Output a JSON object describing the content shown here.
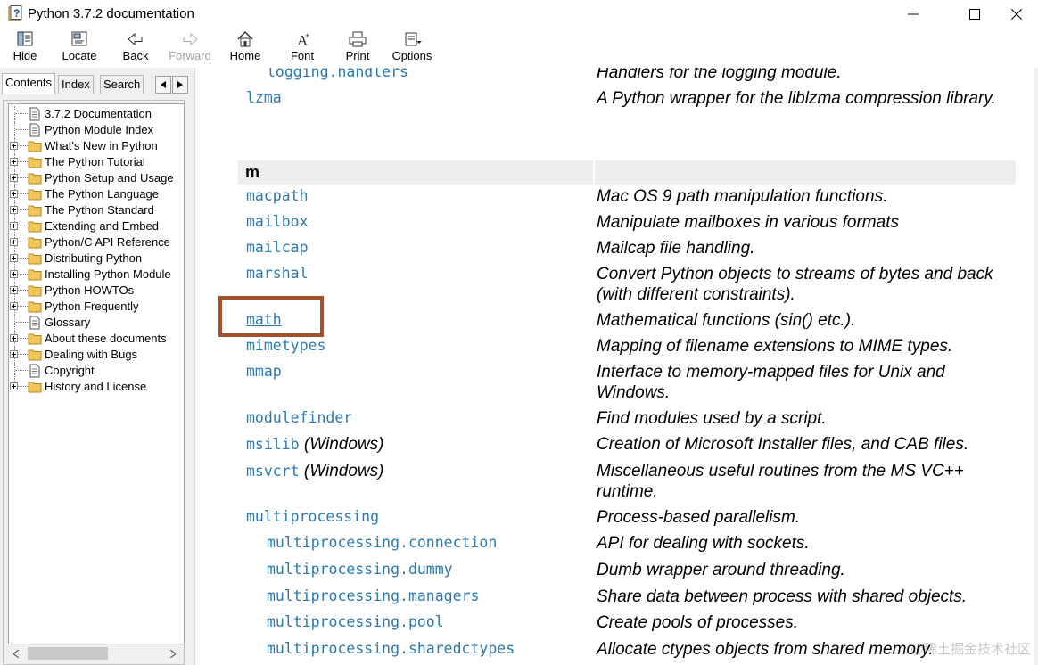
{
  "window": {
    "title": "Python 3.7.2 documentation"
  },
  "toolbar": {
    "hide": "Hide",
    "locate": "Locate",
    "back": "Back",
    "forward": "Forward",
    "home": "Home",
    "font": "Font",
    "print": "Print",
    "options": "Options"
  },
  "tabs": {
    "contents": "Contents",
    "index": "Index",
    "search": "Search"
  },
  "tree": [
    "3.7.2 Documentation",
    "Python Module Index",
    "What's New in Python",
    "The Python Tutorial",
    "Python Setup and Usage",
    "The Python Language",
    "The Python Standard",
    "Extending and Embed",
    "Python/C API Reference",
    "Distributing Python",
    "Installing Python Module",
    "Python HOWTOs",
    "Python Frequently",
    "Glossary",
    "About these documents",
    "Dealing with Bugs",
    "Copyright",
    "History and License"
  ],
  "section_letter": "m",
  "modules": [
    {
      "name": "logging.handlers",
      "desc": "Handlers for the logging module."
    },
    {
      "name": "lzma",
      "desc": "A Python wrapper for the liblzma compression library."
    },
    {
      "name": "macpath",
      "desc": "Mac OS 9 path manipulation functions."
    },
    {
      "name": "mailbox",
      "desc": "Manipulate mailboxes in various formats"
    },
    {
      "name": "mailcap",
      "desc": "Mailcap file handling."
    },
    {
      "name": "marshal",
      "desc": "Convert Python objects to streams of bytes and back (with different constraints)."
    },
    {
      "name": "math",
      "desc": "Mathematical functions (sin() etc.)."
    },
    {
      "name": "mimetypes",
      "desc": "Mapping of filename extensions to MIME types."
    },
    {
      "name": "mmap",
      "desc": "Interface to memory-mapped files for Unix and Windows."
    },
    {
      "name": "modulefinder",
      "desc": "Find modules used by a script."
    },
    {
      "name": "msilib",
      "platform": "(Windows)",
      "desc": "Creation of Microsoft Installer files, and CAB files."
    },
    {
      "name": "msvcrt",
      "platform": "(Windows)",
      "desc": "Miscellaneous useful routines from the MS VC++ runtime."
    },
    {
      "name": "multiprocessing",
      "desc": "Process-based parallelism."
    },
    {
      "name": "multiprocessing.connection",
      "desc": "API for dealing with sockets."
    },
    {
      "name": "multiprocessing.dummy",
      "desc": "Dumb wrapper around threading."
    },
    {
      "name": "multiprocessing.managers",
      "desc": "Share data between process with shared objects."
    },
    {
      "name": "multiprocessing.pool",
      "desc": "Create pools of processes."
    },
    {
      "name": "multiprocessing.sharedctypes",
      "desc": "Allocate ctypes objects from shared memory."
    }
  ],
  "watermark": "@稀土掘金技术社区",
  "colors": {
    "link": "#2a7ab0",
    "highlight_box": "#a0522d"
  }
}
